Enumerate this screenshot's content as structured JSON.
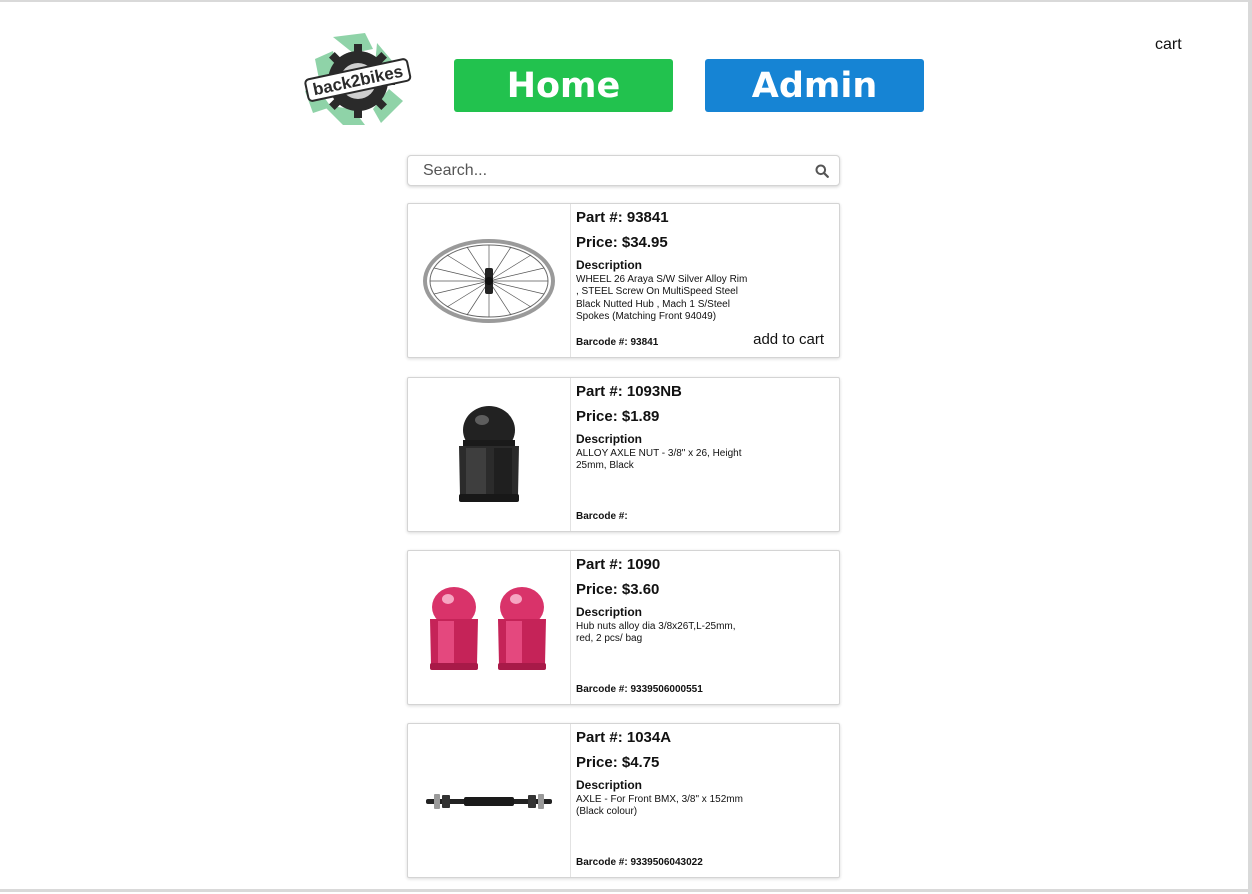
{
  "header": {
    "logo_text": "back2bikes",
    "home_label": "Home",
    "admin_label": "Admin",
    "cart_label": "cart",
    "home_color": "#22c24e",
    "admin_color": "#1684d4"
  },
  "search": {
    "placeholder": "Search...",
    "icon": "search-icon"
  },
  "products": [
    {
      "part": "Part #: 93841",
      "price": "Price: $34.95",
      "description_heading": "Description",
      "description": "WHEEL 26 Araya S/W Silver Alloy Rim , STEEL Screw On MultiSpeed Steel Black Nutted Hub , Mach 1 S/Steel Spokes (Matching Front 94049)",
      "barcode": "Barcode #: 93841",
      "add_to_cart": "add to cart",
      "image": "wheel"
    },
    {
      "part": "Part #: 1093NB",
      "price": "Price: $1.89",
      "description_heading": "Description",
      "description": "ALLOY AXLE NUT - 3/8\" x 26, Height 25mm, Black",
      "barcode": "Barcode #:",
      "image": "black-axle-nut"
    },
    {
      "part": "Part #: 1090",
      "price": "Price: $3.60",
      "description_heading": "Description",
      "description": "Hub nuts alloy dia 3/8x26T,L-25mm, red, 2 pcs/ bag",
      "barcode": "Barcode #: 9339506000551",
      "image": "red-hub-nuts"
    },
    {
      "part": "Part #: 1034A",
      "price": "Price: $4.75",
      "description_heading": "Description",
      "description": "AXLE - For Front BMX, 3/8\" x 152mm (Black colour)",
      "barcode": "Barcode #: 9339506043022",
      "image": "axle"
    }
  ]
}
